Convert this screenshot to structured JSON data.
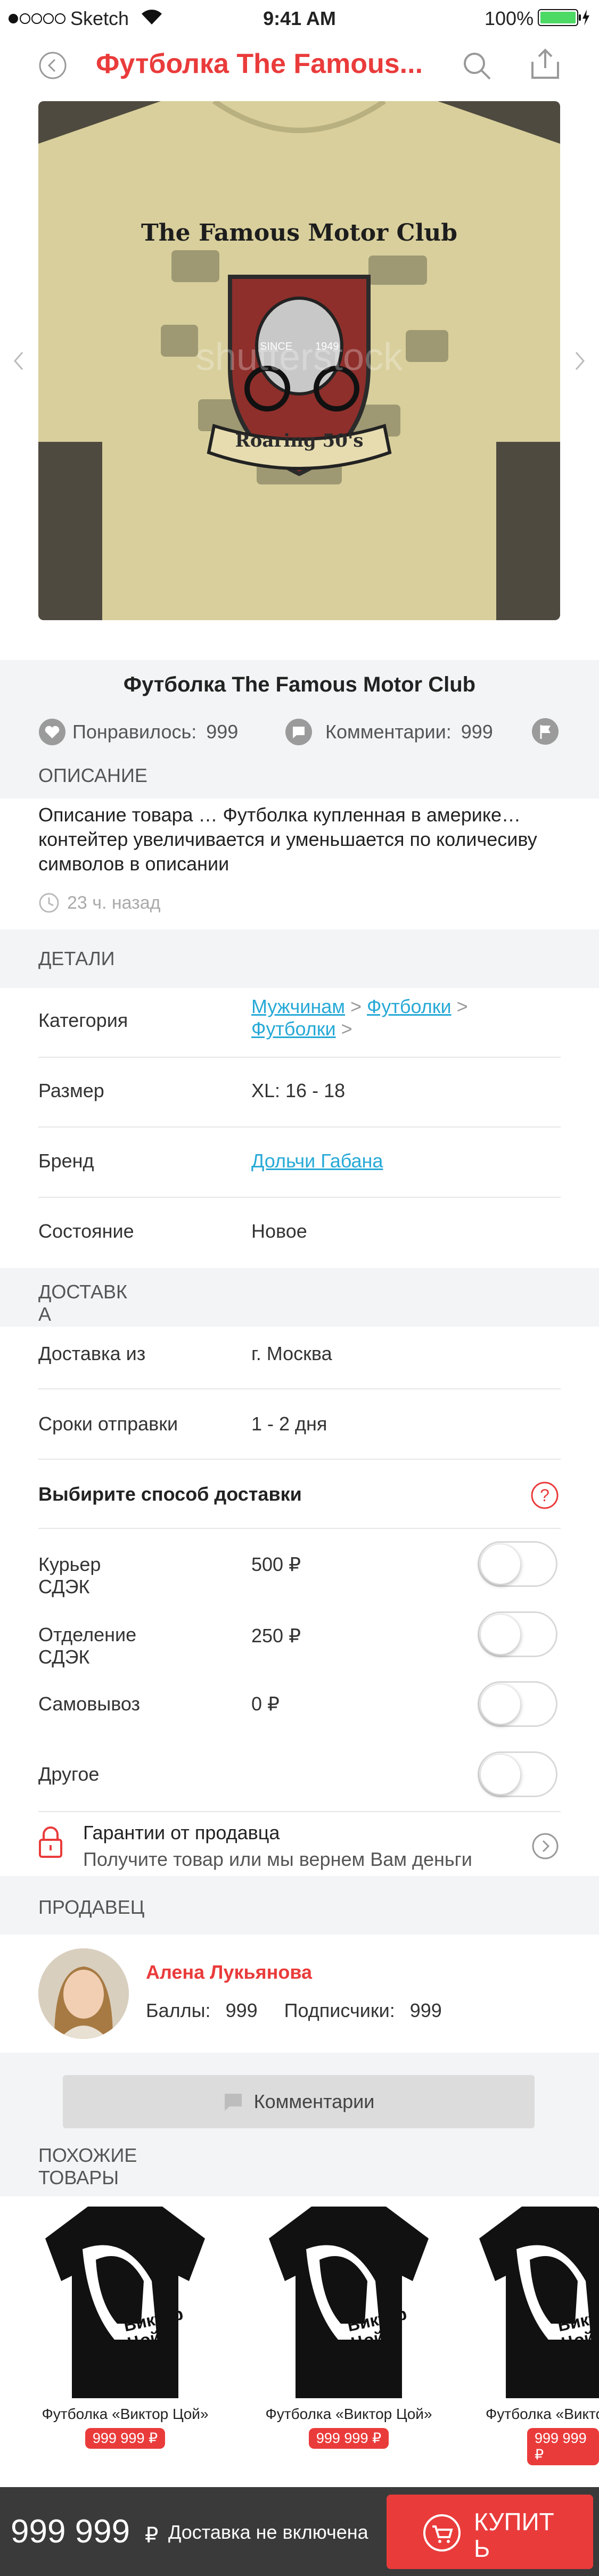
{
  "status_bar": {
    "carrier": "Sketch",
    "time": "9:41 AM",
    "battery": "100%"
  },
  "nav": {
    "title": "Футболка The Famous...",
    "accent": "#ea3b3b"
  },
  "product_image": {
    "headline": "The Famous Motor Club",
    "since_left": "SINCE",
    "since_right": "1949",
    "banner": "Roaring 50's",
    "watermark": "shutterstock"
  },
  "product": {
    "title": "Футболка The Famous Motor Club",
    "likes_label": "Понравилось:",
    "likes_count": "999",
    "comments_label": "Комментарии:",
    "comments_count": "999"
  },
  "description": {
    "header": "ОПИСАНИЕ",
    "text": "Описание товара … Футболка купленная в америке… контейтер увеличивается и уменьшается по количесиву символов в описании",
    "time_ago": "23 ч. назад"
  },
  "details": {
    "header": "ДЕТАЛИ",
    "category_label": "Категория",
    "category_path": [
      "Мужчинам",
      "Футболки",
      "Футболки"
    ],
    "size_label": "Размер",
    "size_value": "XL: 16 - 18",
    "brand_label": "Бренд",
    "brand_value": "Дольчи Габана",
    "condition_label": "Состояние",
    "condition_value": "Новое"
  },
  "delivery": {
    "header_line1": "ДОСТАВК",
    "header_line2": "А",
    "from_label": "Доставка из",
    "from_value": "г. Москва",
    "terms_label": "Сроки отправки",
    "terms_value": "1 - 2 дня",
    "choose_label": "Выбирите способ доставки",
    "options": [
      {
        "label_line1": "Курьер",
        "label_line2": "СДЭК",
        "price": "500 ₽",
        "enabled": false
      },
      {
        "label_line1": "Отделение",
        "label_line2": "СДЭК",
        "price": "250 ₽",
        "enabled": false
      },
      {
        "label_line1": "Самовывоз",
        "label_line2": "",
        "price": "0 ₽",
        "enabled": false
      },
      {
        "label_line1": "Другое",
        "label_line2": "",
        "price": "",
        "enabled": false
      }
    ],
    "guarantee_title": "Гарантии от продавца",
    "guarantee_sub": "Получите товар или мы вернем Вам деньги"
  },
  "seller": {
    "header": "ПРОДАВЕЦ",
    "name": "Алена Лукьянова",
    "points_label": "Баллы:",
    "points_value": "999",
    "subs_label": "Подписчики:",
    "subs_value": "999"
  },
  "comments_button": "Комментарии",
  "similar": {
    "header_line1": "ПОХОЖИЕ",
    "header_line2": "ТОВАРЫ",
    "shirt_print_line1": "Виктор",
    "shirt_print_line2": "Цой",
    "items": [
      {
        "caption": "Футболка «Виктор Цой»",
        "price": "999 999 ₽"
      },
      {
        "caption": "Футболка «Виктор Цой»",
        "price": "999 999 ₽"
      },
      {
        "caption": "Футболка «Виктор Цой»",
        "price": "999 999 ₽"
      }
    ]
  },
  "bottom_bar": {
    "price": "999 999",
    "currency": "₽",
    "delivery_note": "Доставка не включена",
    "buy_line1": "КУПИТ",
    "buy_line2": "Ь"
  },
  "icons": [
    "back-icon",
    "search-icon",
    "share-icon",
    "heart-icon",
    "comment-icon",
    "flag-icon",
    "clock-icon",
    "help-icon",
    "lock-icon",
    "chevron-right-icon",
    "cart-icon"
  ]
}
